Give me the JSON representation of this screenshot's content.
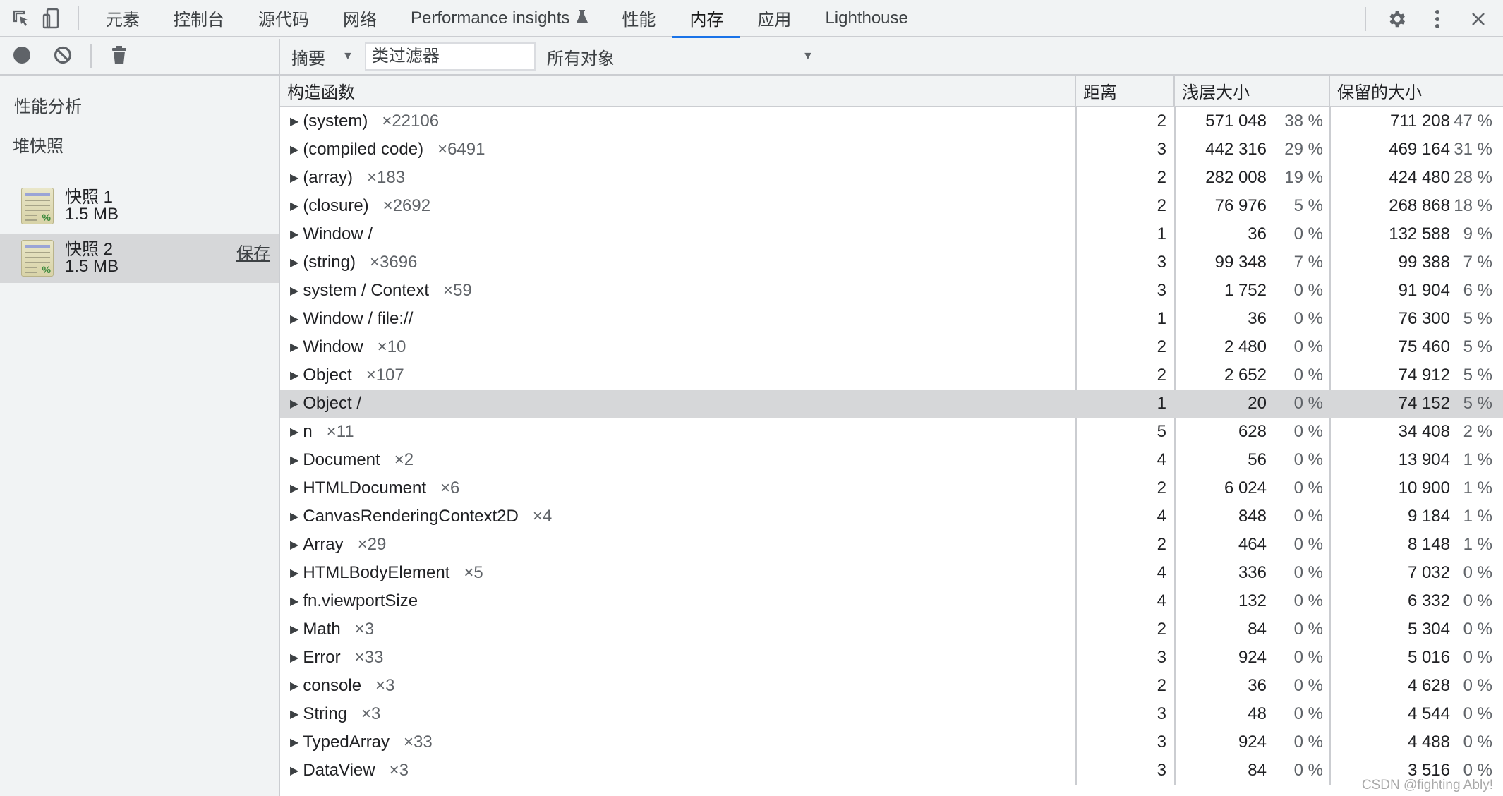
{
  "tabbar": {
    "left_icons": [
      "inspect-element-icon",
      "device-toggle-icon"
    ],
    "tabs": [
      {
        "label": "元素",
        "active": false
      },
      {
        "label": "控制台",
        "active": false
      },
      {
        "label": "源代码",
        "active": false
      },
      {
        "label": "网络",
        "active": false
      },
      {
        "label": "Performance insights",
        "active": false,
        "badge_icon": "flask-icon"
      },
      {
        "label": "性能",
        "active": false
      },
      {
        "label": "内存",
        "active": true
      },
      {
        "label": "应用",
        "active": false
      },
      {
        "label": "Lighthouse",
        "active": false
      }
    ],
    "right_icons": [
      "settings-gear-icon",
      "more-vertical-icon",
      "close-icon"
    ],
    "accent_color": "#1a73e8"
  },
  "toolbar": {
    "left_buttons": [
      "record-icon",
      "clear-icon",
      "trash-icon"
    ],
    "view_select": "摘要",
    "class_filter_placeholder": "类过滤器",
    "object_select": "所有对象"
  },
  "sidebar": {
    "title": "性能分析",
    "group_label": "堆快照",
    "snapshots": [
      {
        "name": "快照 1",
        "size": "1.5 MB",
        "selected": false,
        "save_label": ""
      },
      {
        "name": "快照 2",
        "size": "1.5 MB",
        "selected": true,
        "save_label": "保存"
      }
    ]
  },
  "table": {
    "columns": [
      "构造函数",
      "距离",
      "浅层大小",
      "保留的大小"
    ],
    "selected_row_index": 10,
    "rows": [
      {
        "name": "(system)",
        "count": "×22106",
        "distance": "2",
        "shallow": "571 048",
        "shallow_pct": "38 %",
        "retained": "711 208",
        "retained_pct": "47 %"
      },
      {
        "name": "(compiled code)",
        "count": "×6491",
        "distance": "3",
        "shallow": "442 316",
        "shallow_pct": "29 %",
        "retained": "469 164",
        "retained_pct": "31 %"
      },
      {
        "name": "(array)",
        "count": "×183",
        "distance": "2",
        "shallow": "282 008",
        "shallow_pct": "19 %",
        "retained": "424 480",
        "retained_pct": "28 %"
      },
      {
        "name": "(closure)",
        "count": "×2692",
        "distance": "2",
        "shallow": "76 976",
        "shallow_pct": "5 %",
        "retained": "268 868",
        "retained_pct": "18 %"
      },
      {
        "name": "Window /",
        "count": "",
        "distance": "1",
        "shallow": "36",
        "shallow_pct": "0 %",
        "retained": "132 588",
        "retained_pct": "9 %"
      },
      {
        "name": "(string)",
        "count": "×3696",
        "distance": "3",
        "shallow": "99 348",
        "shallow_pct": "7 %",
        "retained": "99 388",
        "retained_pct": "7 %"
      },
      {
        "name": "system / Context",
        "count": "×59",
        "distance": "3",
        "shallow": "1 752",
        "shallow_pct": "0 %",
        "retained": "91 904",
        "retained_pct": "6 %"
      },
      {
        "name": "Window / file://",
        "count": "",
        "distance": "1",
        "shallow": "36",
        "shallow_pct": "0 %",
        "retained": "76 300",
        "retained_pct": "5 %"
      },
      {
        "name": "Window",
        "count": "×10",
        "distance": "2",
        "shallow": "2 480",
        "shallow_pct": "0 %",
        "retained": "75 460",
        "retained_pct": "5 %"
      },
      {
        "name": "Object",
        "count": "×107",
        "distance": "2",
        "shallow": "2 652",
        "shallow_pct": "0 %",
        "retained": "74 912",
        "retained_pct": "5 %"
      },
      {
        "name": "Object /",
        "count": "",
        "distance": "1",
        "shallow": "20",
        "shallow_pct": "0 %",
        "retained": "74 152",
        "retained_pct": "5 %"
      },
      {
        "name": "n",
        "count": "×11",
        "distance": "5",
        "shallow": "628",
        "shallow_pct": "0 %",
        "retained": "34 408",
        "retained_pct": "2 %"
      },
      {
        "name": "Document",
        "count": "×2",
        "distance": "4",
        "shallow": "56",
        "shallow_pct": "0 %",
        "retained": "13 904",
        "retained_pct": "1 %"
      },
      {
        "name": "HTMLDocument",
        "count": "×6",
        "distance": "2",
        "shallow": "6 024",
        "shallow_pct": "0 %",
        "retained": "10 900",
        "retained_pct": "1 %"
      },
      {
        "name": "CanvasRenderingContext2D",
        "count": "×4",
        "distance": "4",
        "shallow": "848",
        "shallow_pct": "0 %",
        "retained": "9 184",
        "retained_pct": "1 %"
      },
      {
        "name": "Array",
        "count": "×29",
        "distance": "2",
        "shallow": "464",
        "shallow_pct": "0 %",
        "retained": "8 148",
        "retained_pct": "1 %"
      },
      {
        "name": "HTMLBodyElement",
        "count": "×5",
        "distance": "4",
        "shallow": "336",
        "shallow_pct": "0 %",
        "retained": "7 032",
        "retained_pct": "0 %"
      },
      {
        "name": "fn.viewportSize",
        "count": "",
        "distance": "4",
        "shallow": "132",
        "shallow_pct": "0 %",
        "retained": "6 332",
        "retained_pct": "0 %"
      },
      {
        "name": "Math",
        "count": "×3",
        "distance": "2",
        "shallow": "84",
        "shallow_pct": "0 %",
        "retained": "5 304",
        "retained_pct": "0 %"
      },
      {
        "name": "Error",
        "count": "×33",
        "distance": "3",
        "shallow": "924",
        "shallow_pct": "0 %",
        "retained": "5 016",
        "retained_pct": "0 %"
      },
      {
        "name": "console",
        "count": "×3",
        "distance": "2",
        "shallow": "36",
        "shallow_pct": "0 %",
        "retained": "4 628",
        "retained_pct": "0 %"
      },
      {
        "name": "String",
        "count": "×3",
        "distance": "3",
        "shallow": "48",
        "shallow_pct": "0 %",
        "retained": "4 544",
        "retained_pct": "0 %"
      },
      {
        "name": "TypedArray",
        "count": "×33",
        "distance": "3",
        "shallow": "924",
        "shallow_pct": "0 %",
        "retained": "4 488",
        "retained_pct": "0 %"
      },
      {
        "name": "DataView",
        "count": "×3",
        "distance": "3",
        "shallow": "84",
        "shallow_pct": "0 %",
        "retained": "3 516",
        "retained_pct": "0 %"
      }
    ]
  },
  "watermark": "CSDN @fighting Ably!"
}
